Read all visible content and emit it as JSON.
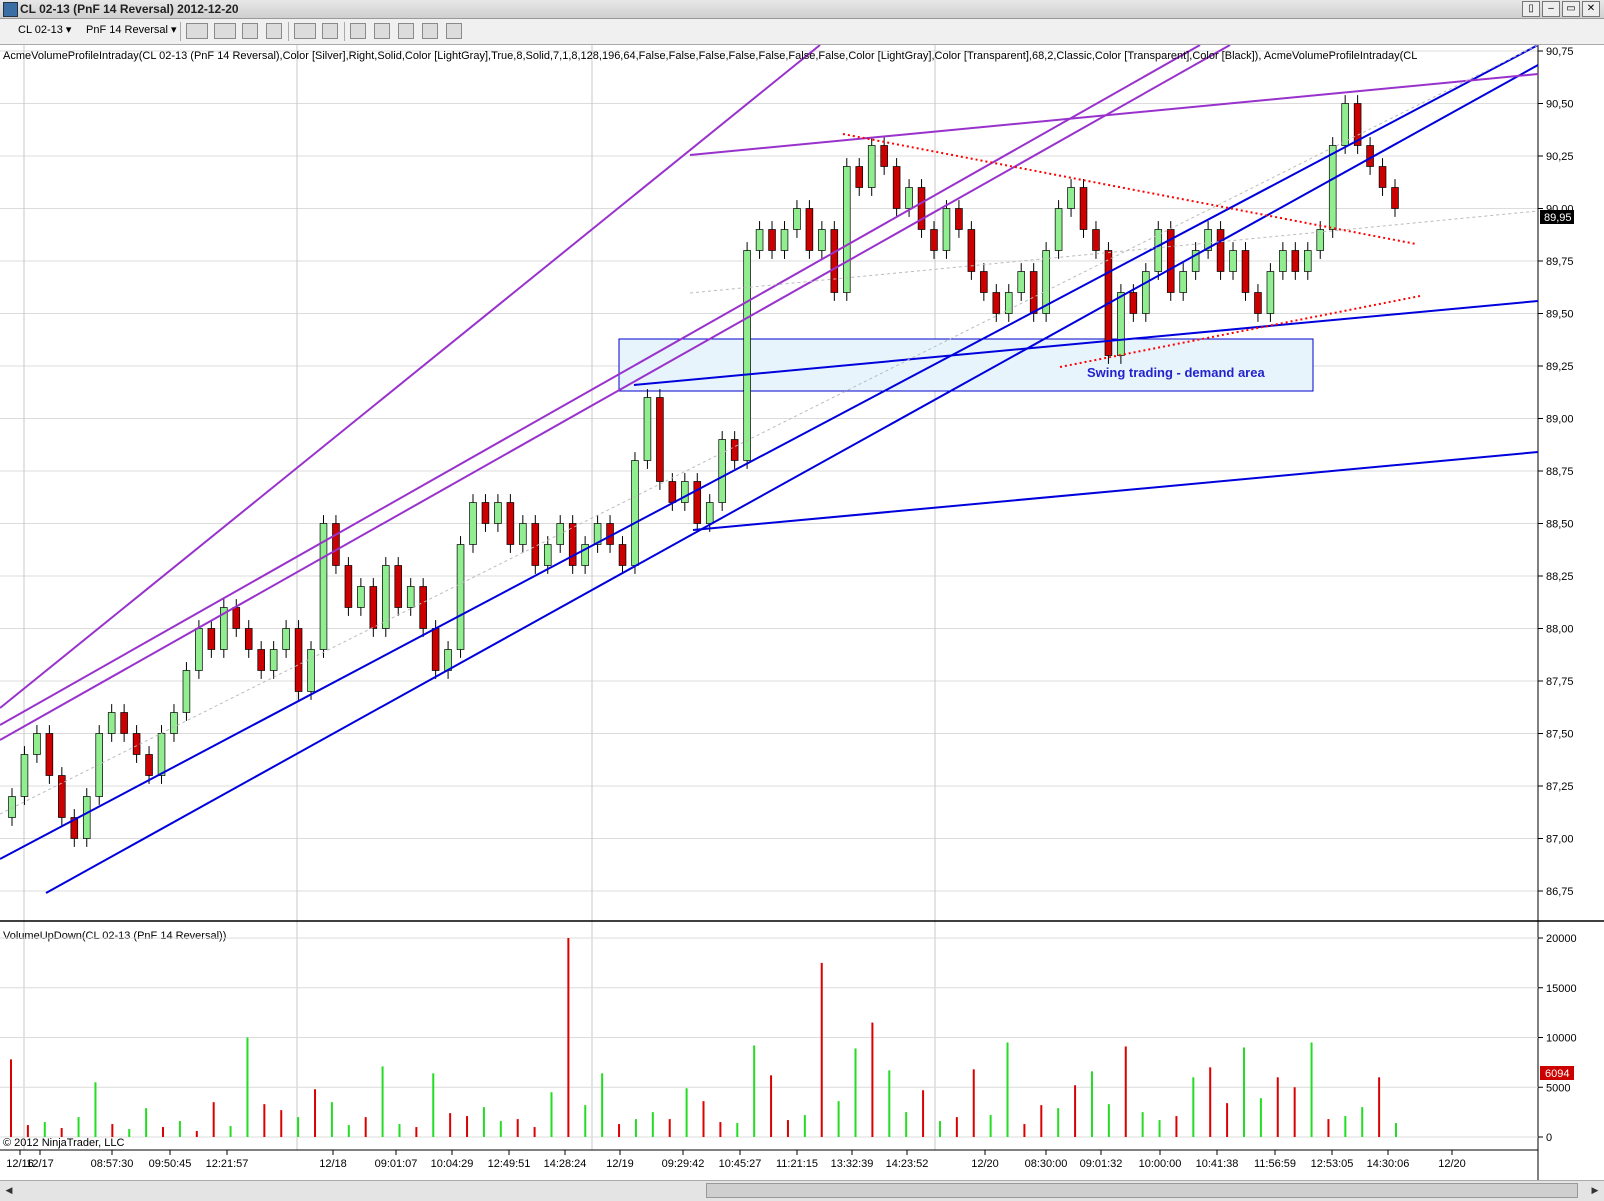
{
  "window": {
    "title": "CL 02-13 (PnF 14 Reversal)  2012-12-20",
    "buttons": [
      "▯",
      "–",
      "▭",
      "✕"
    ]
  },
  "toolbar": {
    "instrument": "CL 02-13",
    "period": "PnF 14 Reversal",
    "icons": [
      "chart-style-icon",
      "drawing-tool-icon",
      "magic-wand-icon",
      "pointer-icon",
      "zoom-icon",
      "data-box-icon",
      "indicators-icon",
      "strategies-icon",
      "properties-icon",
      "price-icon"
    ]
  },
  "price_panel": {
    "indicator_label": "AcmeVolumeProfileIntraday(CL 02-13 (PnF 14 Reversal),Color [Silver],Right,Solid,Color [LightGray],True,8,Solid,7,1,8,128,196,64,False,False,False,False,False,False,False,Color [LightGray],Color [Transparent],68,2,Classic,Color [Transparent],Color [Black]), AcmeVolumeProfileIntraday(CL",
    "y_ticks": [
      "90,75",
      "90,50",
      "90,25",
      "90,00",
      "89,75",
      "89,50",
      "89,25",
      "89,00",
      "88,75",
      "88,50",
      "88,25",
      "88,00",
      "87,75",
      "87,50",
      "87,25",
      "87,00",
      "86,75"
    ],
    "current_price": "89,95",
    "annotation": "Swing trading - demand area",
    "colors": {
      "up": "#90ee90",
      "down": "#cc0000",
      "channel": "#0000dd",
      "upper_channel": "#9932cc",
      "dotted": "#ff0000"
    }
  },
  "volume_panel": {
    "indicator_label": "VolumeUpDown(CL 02-13 (PnF 14 Reversal))",
    "y_ticks": [
      "20000",
      "15000",
      "10000",
      "5000",
      "0"
    ],
    "current_volume": "6094"
  },
  "x_ticks": [
    "12/16",
    "12/17",
    "08:57:30",
    "09:50:45",
    "12:21:57",
    "12/18",
    "09:01:07",
    "10:04:29",
    "12:49:51",
    "14:28:24",
    "12/19",
    "09:29:42",
    "10:45:27",
    "11:21:15",
    "13:32:39",
    "14:23:52",
    "12/20",
    "08:30:00",
    "09:01:32",
    "10:00:00",
    "10:41:38",
    "11:56:59",
    "12:53:05",
    "14:30:06",
    "12/20"
  ],
  "copyright": "© 2012 NinjaTrader, LLC",
  "chart_data": {
    "type": "candlestick",
    "ylim_price": [
      86.75,
      90.75
    ],
    "ylim_volume": [
      0,
      20000
    ],
    "approx_closes": [
      87.2,
      87.4,
      87.5,
      87.3,
      87.1,
      87.0,
      87.2,
      87.5,
      87.6,
      87.5,
      87.4,
      87.3,
      87.5,
      87.6,
      87.8,
      88.0,
      87.9,
      88.1,
      88.0,
      87.9,
      87.8,
      87.9,
      88.0,
      87.7,
      87.9,
      88.5,
      88.3,
      88.1,
      88.2,
      88.0,
      88.3,
      88.1,
      88.2,
      88.0,
      87.8,
      87.9,
      88.4,
      88.6,
      88.5,
      88.6,
      88.4,
      88.5,
      88.3,
      88.4,
      88.5,
      88.3,
      88.4,
      88.5,
      88.4,
      88.3,
      88.8,
      89.1,
      88.7,
      88.6,
      88.7,
      88.5,
      88.6,
      88.9,
      88.8,
      89.8,
      89.9,
      89.8,
      89.9,
      90.0,
      89.8,
      89.9,
      89.6,
      90.2,
      90.1,
      90.3,
      90.2,
      90.0,
      90.1,
      89.9,
      89.8,
      90.0,
      89.9,
      89.7,
      89.6,
      89.5,
      89.6,
      89.7,
      89.5,
      89.8,
      90.0,
      90.1,
      89.9,
      89.8,
      89.3,
      89.6,
      89.5,
      89.7,
      89.9,
      89.6,
      89.7,
      89.8,
      89.9,
      89.7,
      89.8,
      89.6,
      89.5,
      89.7,
      89.8,
      89.7,
      89.8,
      89.9,
      90.3,
      90.5,
      90.3,
      90.2,
      90.1,
      90.0
    ],
    "approx_volumes": [
      7800,
      1200,
      1500,
      900,
      2000,
      5500,
      1300,
      800,
      2900,
      1000,
      1600,
      600,
      3500,
      1100,
      10000,
      3300,
      2700,
      2000,
      4800,
      3500,
      1200,
      2000,
      7100,
      1300,
      1000,
      6400,
      2400,
      2100,
      3000,
      1600,
      1800,
      1000,
      4500,
      20000,
      3200,
      6400,
      1300,
      1800,
      2500,
      1800,
      4900,
      3600,
      1500,
      1400,
      9200,
      6200,
      1700,
      2200,
      17500,
      3600,
      8900,
      11500,
      6700,
      2500,
      4700,
      1600,
      2000,
      6800,
      2200,
      9500,
      1300,
      3200,
      2900,
      5200,
      6600,
      3300,
      9100,
      2500,
      1700,
      2100,
      6000,
      7000,
      3400,
      9000,
      3900,
      6000,
      5000,
      9500,
      1800,
      2100,
      3000,
      6000,
      1400
    ]
  }
}
